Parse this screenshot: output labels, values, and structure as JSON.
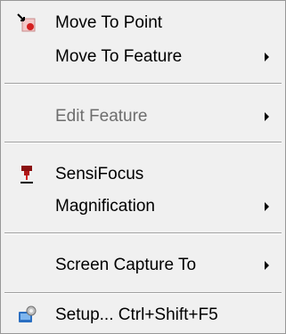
{
  "menu": {
    "items": [
      {
        "label": "Move To Point",
        "icon": "move-to-point-icon",
        "submenu": false,
        "enabled": true
      },
      {
        "label": "Move To Feature",
        "icon": null,
        "submenu": true,
        "enabled": true
      },
      {
        "label": "Edit Feature",
        "icon": null,
        "submenu": true,
        "enabled": false
      },
      {
        "label": "SensiFocus",
        "icon": "sensifocus-probe-icon",
        "submenu": false,
        "enabled": true
      },
      {
        "label": "Magnification",
        "icon": null,
        "submenu": true,
        "enabled": true
      },
      {
        "label": "Screen Capture To",
        "icon": null,
        "submenu": true,
        "enabled": true
      },
      {
        "label": "Setup...  Ctrl+Shift+F5",
        "icon": "setup-icon",
        "submenu": false,
        "enabled": true
      }
    ]
  },
  "colors": {
    "menu_background": "#f0f0f0",
    "disabled_text": "#6d6d6d",
    "icon_red": "#d42020",
    "icon_blue": "#2a6fc2"
  }
}
